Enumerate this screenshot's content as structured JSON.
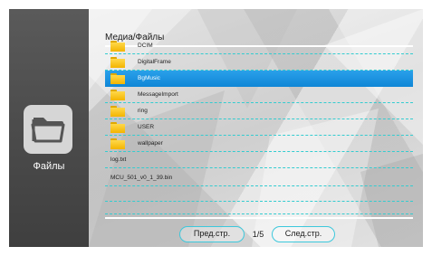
{
  "sidebar": {
    "icon": "folder-icon",
    "label": "Файлы"
  },
  "header": {
    "title": "Медиа/Файлы"
  },
  "files": [
    {
      "name": "DCIM",
      "type": "folder",
      "selected": false
    },
    {
      "name": "DigitalFrame",
      "type": "folder",
      "selected": false
    },
    {
      "name": "BgMusic",
      "type": "folder",
      "selected": true
    },
    {
      "name": "MessageImport",
      "type": "folder",
      "selected": false
    },
    {
      "name": "ring",
      "type": "folder",
      "selected": false
    },
    {
      "name": "USER",
      "type": "folder",
      "selected": false
    },
    {
      "name": "wallpaper",
      "type": "folder",
      "selected": false
    },
    {
      "name": "log.txt",
      "type": "file",
      "selected": false
    },
    {
      "name": "MCU_501_v0_1_39.bin",
      "type": "file",
      "selected": false
    }
  ],
  "pagination": {
    "prev_label": "Пред.стр.",
    "next_label": "След.стр.",
    "page_indicator": "1/5",
    "current_page": 1,
    "total_pages": 5
  },
  "colors": {
    "selection": "#1a8fdc",
    "divider": "#33ccd0",
    "sidebar_bg": "#4d4d4d",
    "folder": "#f3b400"
  }
}
